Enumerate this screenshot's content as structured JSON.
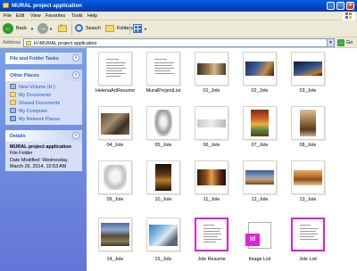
{
  "window": {
    "title": "MURAL project application"
  },
  "menu": [
    "File",
    "Edit",
    "View",
    "Favorites",
    "Tools",
    "Help"
  ],
  "toolbar": {
    "back": "Back",
    "search": "Search",
    "folders": "Folders"
  },
  "address": {
    "label": "Address",
    "path": "H:\\MURAL project application",
    "go": "Go"
  },
  "tasks_panel": {
    "title": "File and Folder Tasks"
  },
  "places_panel": {
    "title": "Other Places",
    "items": [
      "New Volume (H:)",
      "My Documents",
      "Shared Documents",
      "My Computer",
      "My Network Places"
    ]
  },
  "details_panel": {
    "title": "Details",
    "name": "MURAL project application",
    "type": "File Folder",
    "modified_line1": "Date Modified: Wednesday,",
    "modified_line2": "March 26, 2014, 10:53 AM"
  },
  "files": [
    {
      "name": "HelenaArtResume",
      "kind": "doc"
    },
    {
      "name": "MuralProjectList",
      "kind": "doc"
    },
    {
      "name": "01_Jole",
      "kind": "photo"
    },
    {
      "name": "02_Jole",
      "kind": "photo"
    },
    {
      "name": "03_Jole",
      "kind": "photo"
    },
    {
      "name": "04_Jole",
      "kind": "photo"
    },
    {
      "name": "05_Jole",
      "kind": "photo"
    },
    {
      "name": "06_Jole",
      "kind": "photo"
    },
    {
      "name": "07_Jole",
      "kind": "photo"
    },
    {
      "name": "08_Jole",
      "kind": "photo"
    },
    {
      "name": "09_Jole",
      "kind": "photo"
    },
    {
      "name": "10_Jole",
      "kind": "photo"
    },
    {
      "name": "11_Jole",
      "kind": "photo"
    },
    {
      "name": "12_Jole",
      "kind": "photo"
    },
    {
      "name": "13_Jole",
      "kind": "photo"
    },
    {
      "name": "14_Jole",
      "kind": "photo"
    },
    {
      "name": "15_Jole",
      "kind": "photo"
    },
    {
      "name": "Jole Resume",
      "kind": "doc-pink"
    },
    {
      "name": "Image List",
      "kind": "indesign"
    },
    {
      "name": "Jole List",
      "kind": "doc-pink"
    }
  ],
  "indesign_badge": "Id",
  "colors": {
    "titlebar": "#0a5fe0",
    "left_pane": "#7ba2e7",
    "panel": "#d6dff7",
    "link": "#215dc6",
    "pink_border": "#e020d8"
  }
}
